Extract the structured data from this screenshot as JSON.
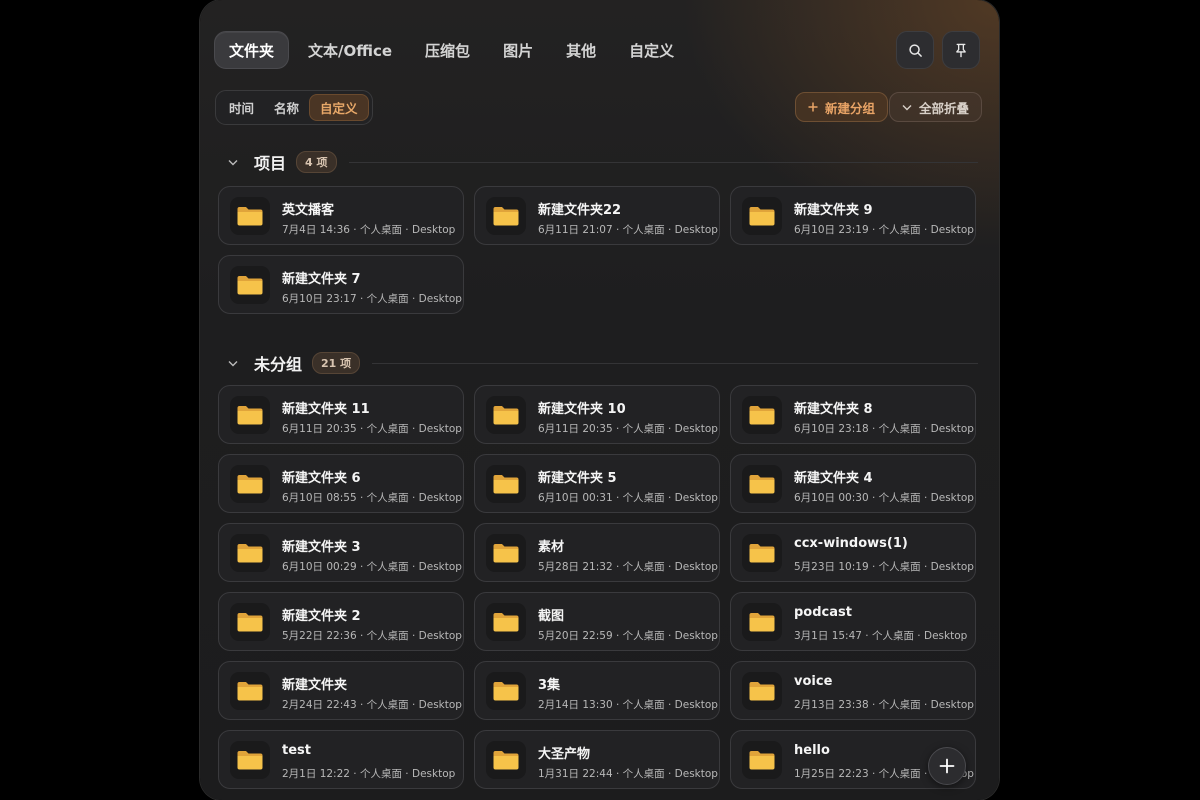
{
  "tabs": [
    "文件夹",
    "文本/Office",
    "压缩包",
    "图片",
    "其他",
    "自定义"
  ],
  "active_tab": 0,
  "toolbar": {
    "search_icon": "search-icon",
    "pin_icon": "pin-icon"
  },
  "sort": {
    "options": [
      "时间",
      "名称",
      "自定义"
    ],
    "active": 2
  },
  "actions": {
    "new_group": "新建分组",
    "collapse_all": "全部折叠"
  },
  "colors": {
    "accent": "#e9a466",
    "folder": "#f6c34a",
    "background": "#1e1e1f"
  },
  "groups": [
    {
      "title": "项目",
      "count": "4 项",
      "items": [
        {
          "name": "英文播客",
          "meta": "7月4日 14:36 · 个人桌面 · Desktop"
        },
        {
          "name": "新建文件夹22",
          "meta": "6月11日 21:07 · 个人桌面 · Desktop"
        },
        {
          "name": "新建文件夹 9",
          "meta": "6月10日 23:19 · 个人桌面 · Desktop"
        },
        {
          "name": "新建文件夹 7",
          "meta": "6月10日 23:17 · 个人桌面 · Desktop"
        }
      ]
    },
    {
      "title": "未分组",
      "count": "21 项",
      "items": [
        {
          "name": "新建文件夹 11",
          "meta": "6月11日 20:35 · 个人桌面 · Desktop"
        },
        {
          "name": "新建文件夹 10",
          "meta": "6月11日 20:35 · 个人桌面 · Desktop"
        },
        {
          "name": "新建文件夹 8",
          "meta": "6月10日 23:18 · 个人桌面 · Desktop"
        },
        {
          "name": "新建文件夹 6",
          "meta": "6月10日 08:55 · 个人桌面 · Desktop"
        },
        {
          "name": "新建文件夹 5",
          "meta": "6月10日 00:31 · 个人桌面 · Desktop"
        },
        {
          "name": "新建文件夹 4",
          "meta": "6月10日 00:30 · 个人桌面 · Desktop"
        },
        {
          "name": "新建文件夹 3",
          "meta": "6月10日 00:29 · 个人桌面 · Desktop"
        },
        {
          "name": "素材",
          "meta": "5月28日 21:32 · 个人桌面 · Desktop"
        },
        {
          "name": "ccx-windows(1)",
          "meta": "5月23日 10:19 · 个人桌面 · Desktop"
        },
        {
          "name": "新建文件夹 2",
          "meta": "5月22日 22:36 · 个人桌面 · Desktop"
        },
        {
          "name": "截图",
          "meta": "5月20日 22:59 · 个人桌面 · Desktop"
        },
        {
          "name": "podcast",
          "meta": "3月1日 15:47 · 个人桌面 · Desktop"
        },
        {
          "name": "新建文件夹",
          "meta": "2月24日 22:43 · 个人桌面 · Desktop"
        },
        {
          "name": "3集",
          "meta": "2月14日 13:30 · 个人桌面 · Desktop"
        },
        {
          "name": "voice",
          "meta": "2月13日 23:38 · 个人桌面 · Desktop"
        },
        {
          "name": "test",
          "meta": "2月1日 12:22 · 个人桌面 · Desktop"
        },
        {
          "name": "大圣产物",
          "meta": "1月31日 22:44 · 个人桌面 · Desktop"
        },
        {
          "name": "hello",
          "meta": "1月25日 22:23 · 个人桌面 · Desktop"
        }
      ]
    }
  ],
  "fab": {
    "icon": "plus-icon"
  }
}
